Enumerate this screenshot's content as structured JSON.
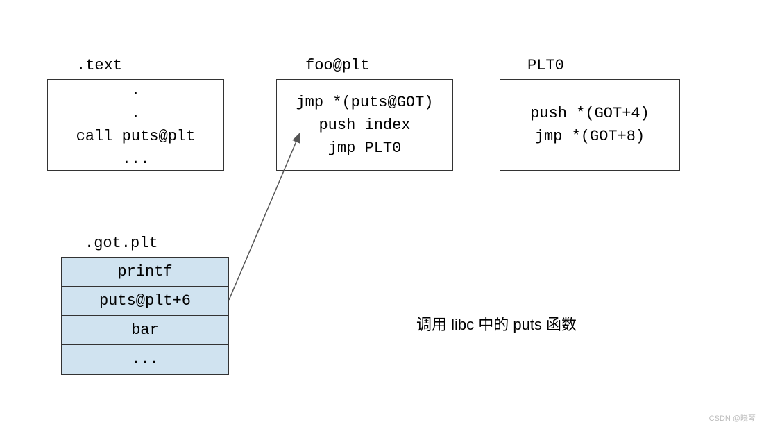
{
  "boxes": {
    "text": {
      "label": ".text",
      "lines": [
        ".",
        ".",
        "call puts@plt",
        "..."
      ]
    },
    "foo_plt": {
      "label": "foo@plt",
      "lines": [
        "jmp *(puts@GOT)",
        "push index",
        "jmp PLT0"
      ]
    },
    "plt0": {
      "label": "PLT0",
      "lines": [
        "push *(GOT+4)",
        "jmp *(GOT+8)"
      ]
    }
  },
  "got_plt": {
    "label": ".got.plt",
    "rows": [
      "printf",
      "puts@plt+6",
      "bar",
      "..."
    ]
  },
  "caption": "调用 libc 中的 puts 函数",
  "watermark": "CSDN @晓琴"
}
